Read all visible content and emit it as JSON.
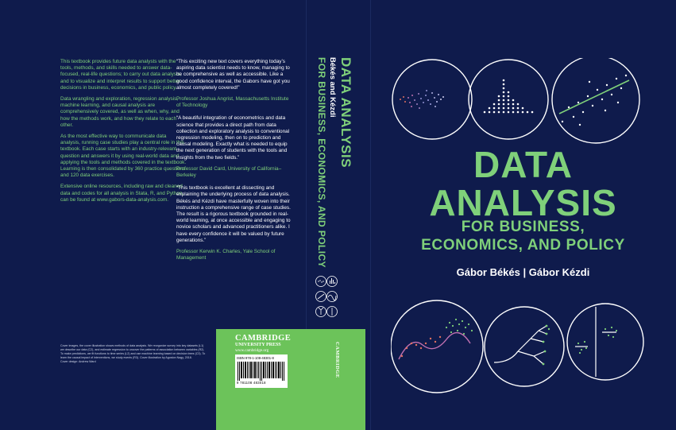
{
  "back": {
    "blurb": [
      "This textbook provides future data analysts with the tools, methods, and skills needed to answer data-focused, real-life questions; to carry out data analysis; and to visualize and interpret results to support better decisions in business, economics, and public policy.",
      "Data wrangling and exploration, regression analysis, machine learning, and causal analysis are comprehensively covered, as well as when, why, and how the methods work, and how they relate to each other.",
      "As the most effective way to communicate data analysis, running case studies play a central role in this textbook. Each case starts with an industry-relevant question and answers it by using real-world data and applying the tools and methods covered in the textbook. Learning is then consolidated by 360 practice questions and 120 data exercises.",
      "Extensive online resources, including raw and cleaned data and codes for all analysis in Stata, R, and Python, can be found at www.gabors-data-analysis.com."
    ],
    "quotes": [
      {
        "text": "“This exciting new text covers everything today’s aspiring data scientist needs to know, managing to be comprehensive as well as accessible. Like a good confidence interval, the Gabors have got you almost completely covered!”",
        "attribution": "Professor Joshua Angrist, Massachusetts Institute of Technology"
      },
      {
        "text": "“A beautiful integration of econometrics and data science that provides a direct path from data collection and exploratory analysis to conventional regression modeling, then on to prediction and causal modeling. Exactly what is needed to equip the next generation of students with the tools and insights from the two fields.”",
        "attribution": "Professor David Card, University of California–Berkeley"
      },
      {
        "text": "“This textbook is excellent at dissecting and explaining the underlying process of data analysis. Békés and Kézdi have masterfully woven into their instruction a comprehensive range of case studies. The result is a rigorous textbook grounded in real-world learning, at once accessible and engaging to novice scholars and advanced practitioners alike. I have every confidence it will be valued by future generations.”",
        "attribution": "Professor Kerwin K. Charles, Yale School of Management"
      }
    ],
    "credits": [
      "Cover images, the cover illustration shows methods of data analysis. We reorganize survey into key datasets (L1) we describe our data (C2), and estimate regression to uncover the patterns of association between variables (R2). To make predictions, we fit functions to time series (L2) and use machine learning based on decision trees (C3). To learn the causal impact of interventions, we study events (R3). Cover illustration by Agoston Nagy, 2018.",
      "Cover design: Andrew Ward"
    ],
    "publisher": {
      "name": "CAMBRIDGE",
      "sub": "UNIVERSITY PRESS",
      "url": "www.cambridge.org"
    },
    "isbn": "ISBN 978-1-108-48301-8",
    "barcode_digits": "9 781108 483018"
  },
  "spine": {
    "authors": "Békés and Kézdi",
    "title": "DATA ANALYSIS",
    "subtitle_1": "FOR BUSINESS,",
    "subtitle_2": "ECONOMICS, AND POLICY",
    "publisher": "CAMBRIDGE"
  },
  "front": {
    "title_1": "DATA",
    "title_2": "ANALYSIS",
    "subtitle_1": "FOR BUSINESS,",
    "subtitle_2": "ECONOMICS, AND POLICY",
    "authors": "Gábor Békés | Gábor Kézdi"
  },
  "colors": {
    "background": "#0f1b4c",
    "accent_green": "#7fd07a",
    "panel_green": "#6cc35a",
    "ink_white": "#ffffff"
  },
  "icons": [
    "scatter-cloud-icon",
    "dot-histogram-icon",
    "regression-scatter-icon",
    "time-series-curve-icon",
    "decision-tree-icon",
    "event-study-icon"
  ]
}
